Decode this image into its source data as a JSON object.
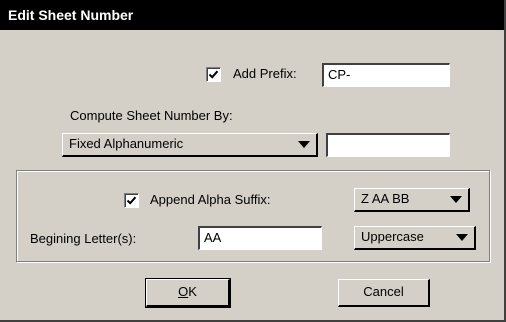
{
  "dialog": {
    "title": "Edit Sheet Number",
    "add_prefix": {
      "label": "Add Prefix:",
      "checked": true,
      "value": "CP-"
    },
    "compute_by": {
      "label": "Compute Sheet Number By:",
      "selected": "Fixed Alphanumeric",
      "value": ""
    },
    "suffix_group": {
      "append_alpha_suffix": {
        "label": "Append Alpha Suffix:",
        "checked": true
      },
      "suffix_style": {
        "selected": "Z AA BB"
      },
      "beginning_letters": {
        "label": "Begining Letter(s):",
        "value": "AA"
      },
      "case": {
        "selected": "Uppercase"
      }
    },
    "buttons": {
      "ok_mnemonic": "O",
      "ok_rest": "K",
      "cancel": "Cancel"
    }
  }
}
